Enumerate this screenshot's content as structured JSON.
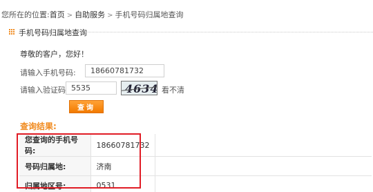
{
  "breadcrumb": {
    "prefix": "您所在的位置:",
    "items": [
      "首页",
      "自助服务"
    ],
    "current": "手机号码归属地查询"
  },
  "section": {
    "title": "手机号码归属地查询",
    "accent_color": "#f08a1e"
  },
  "greeting": "尊敬的客户，您好！",
  "form": {
    "phone_label": "请输入手机号码:",
    "phone_value": "18660781732",
    "code_label": "请输入验证码:",
    "code_value": "5535",
    "captcha_text": "4634",
    "refresh_label": "看不清",
    "submit_label": "查询"
  },
  "result": {
    "title": "查询结果:",
    "rows": [
      {
        "key": "您查询的手机号码:",
        "value": "18660781732"
      },
      {
        "key": "号码归属地:",
        "value": "济南"
      },
      {
        "key": "归属地区号:",
        "value": "0531"
      }
    ],
    "highlight_color": "#e01b24"
  }
}
